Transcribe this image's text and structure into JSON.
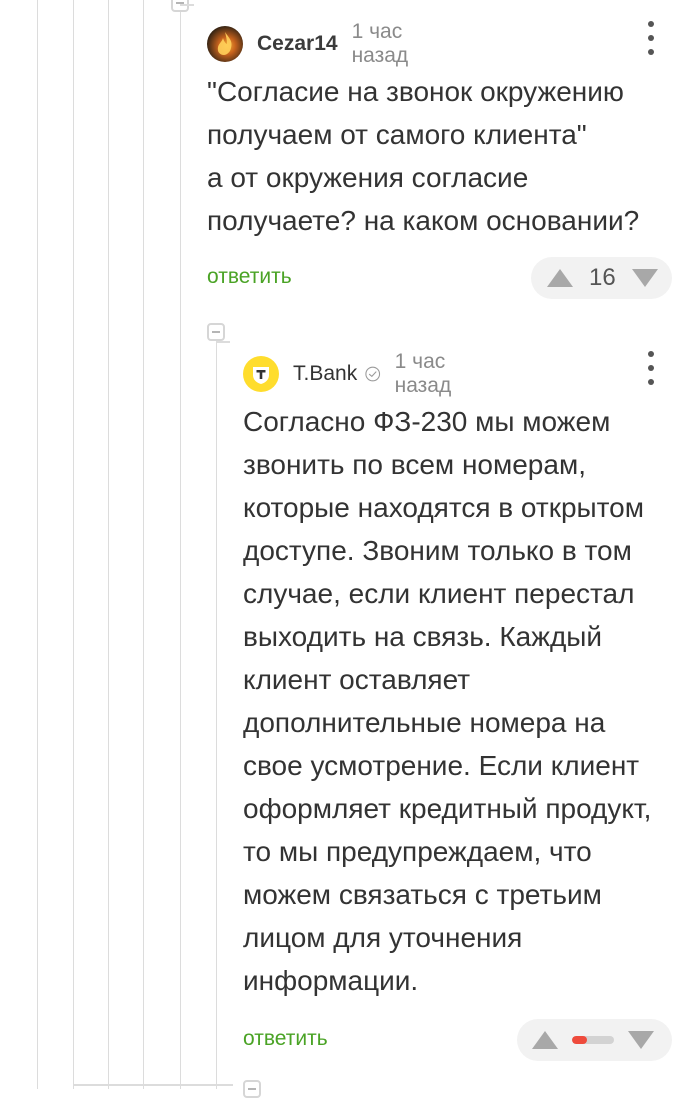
{
  "comments": [
    {
      "author": "Cezar14",
      "time": "1 час назад",
      "text": "\"Согласие на звонок окружению\nполучаем от самого клиента\"\nа от окружения согласие\nполучаете? на каком основании?",
      "reply_label": "ответить",
      "score": "16",
      "avatar_icon": "flame-avatar-icon"
    },
    {
      "author": "T.Bank",
      "time": "1 час назад",
      "verified": true,
      "text": "Согласно ФЗ-230 мы можем\nзвонить по всем номерам,\nкоторые находятся в открытом\nдоступе. Звоним только в том\nслучае, если клиент перестал\nвыходить на связь. Каждый\nклиент оставляет\nдополнительные номера на\nсвое усмотрение. Если клиент\nоформляет кредитный продукт,\nто мы предупреждаем, что\nможем связаться с третьим\nлицом для уточнения\nинформации.",
      "reply_label": "ответить",
      "rating_fraction": 0.35,
      "avatar_icon": "tbank-logo-icon"
    }
  ],
  "colors": {
    "accent_green": "#4aa325",
    "vote_bg": "#f2f2f2",
    "negative_red": "#ef4b3c",
    "tbank_yellow": "#ffdd2d"
  }
}
